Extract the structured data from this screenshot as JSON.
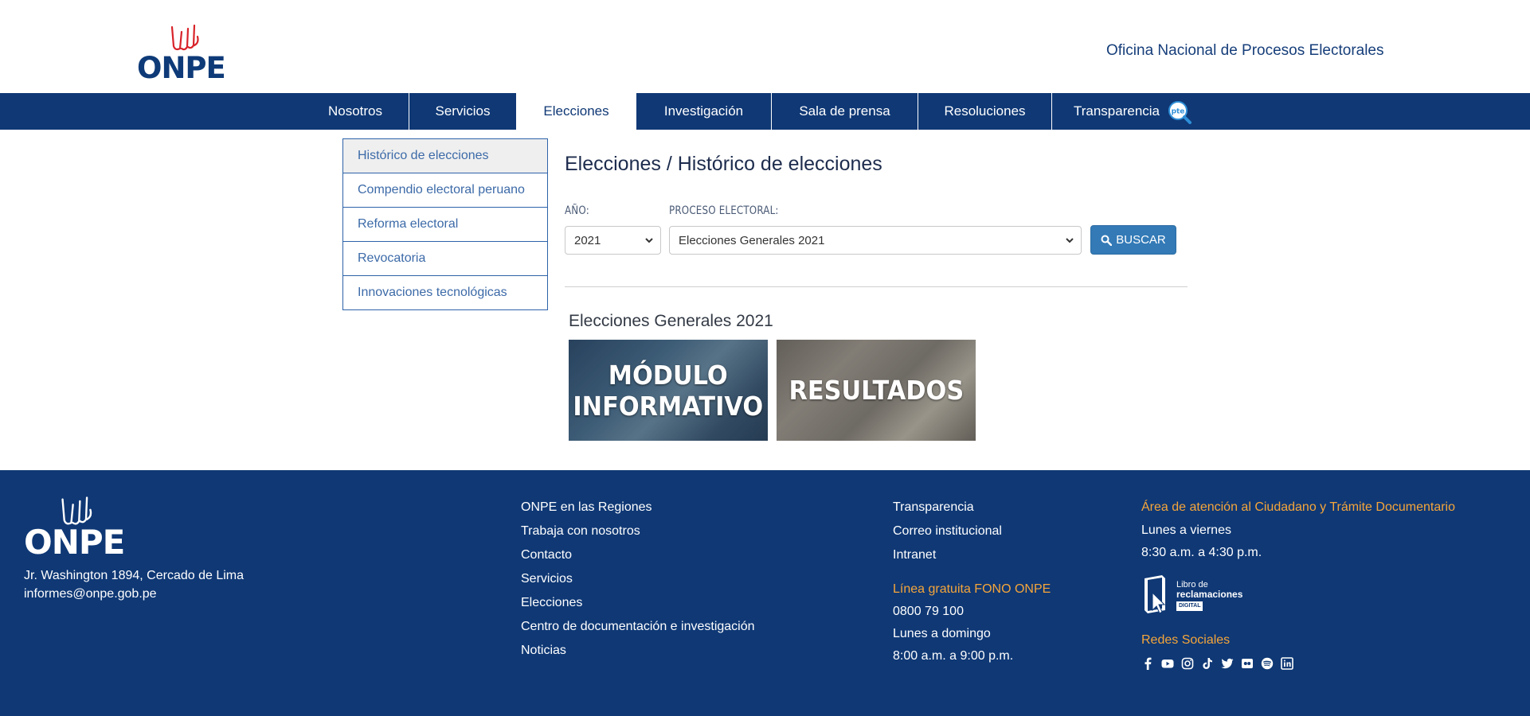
{
  "header": {
    "logo_text": "ONPE",
    "org_name": "Oficina Nacional de Procesos Electorales"
  },
  "nav": {
    "items": [
      {
        "label": "Nosotros"
      },
      {
        "label": "Servicios"
      },
      {
        "label": "Elecciones"
      },
      {
        "label": "Investigación"
      },
      {
        "label": "Sala de prensa"
      },
      {
        "label": "Resoluciones"
      },
      {
        "label": "Transparencia"
      }
    ],
    "active_item": "Elecciones",
    "pte_icon_text": "pte"
  },
  "sidebar": {
    "items": [
      {
        "label": "Histórico de elecciones"
      },
      {
        "label": "Compendio electoral peruano"
      },
      {
        "label": "Reforma electoral"
      },
      {
        "label": "Revocatoria"
      },
      {
        "label": "Innovaciones tecnológicas"
      }
    ]
  },
  "main": {
    "title": "Elecciones / Histórico de elecciones",
    "year_label": "AÑO:",
    "year_value": "2021",
    "process_label": "PROCESO ELECTORAL:",
    "process_value": "Elecciones Generales 2021",
    "search_button": "BUSCAR",
    "section_title": "Elecciones Generales 2021",
    "tiles": [
      {
        "line1": "MÓDULO",
        "line2": "INFORMATIVO"
      },
      {
        "line1": "RESULTADOS",
        "line2": ""
      }
    ]
  },
  "footer": {
    "logo_text": "ONPE",
    "address": "Jr. Washington 1894, Cercado de Lima",
    "email": "informes@onpe.gob.pe",
    "links_col1": [
      "ONPE en las Regiones",
      "Trabaja con nosotros",
      "Contacto",
      "Servicios",
      "Elecciones",
      "Centro de documentación e investigación",
      "Noticias"
    ],
    "links_col2": [
      "Transparencia",
      "Correo institucional",
      "Intranet"
    ],
    "hotline_title": "Línea gratuita FONO ONPE",
    "hotline_number": "0800 79 100",
    "hotline_days": "Lunes a domingo",
    "hotline_hours": "8:00 a.m. a 9:00 p.m.",
    "attention_title": "Área de atención al Ciudadano y Trámite Documentario",
    "attention_days": "Lunes a viernes",
    "attention_hours": "8:30 a.m. a 4:30 p.m.",
    "libro_line1": "Libro de",
    "libro_line2": "reclamaciones",
    "libro_badge": "DIGITAL",
    "social_title": "Redes Sociales",
    "social_icons": [
      "facebook-icon",
      "youtube-icon",
      "instagram-icon",
      "tiktok-icon",
      "twitter-icon",
      "flickr-icon",
      "spotify-icon",
      "linkedin-icon"
    ]
  },
  "colors": {
    "brand_blue": "#0f3875",
    "button_blue": "#337ab7",
    "accent_orange": "#f5a53a",
    "logo_red": "#d8232a"
  }
}
